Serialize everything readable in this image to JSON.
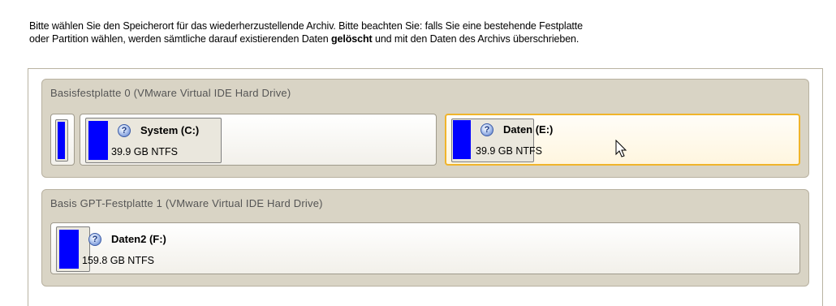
{
  "instructions": {
    "line1": "Bitte wählen Sie den Speicherort für das wiederherzustellende Archiv. Bitte beachten Sie: falls Sie eine bestehende Festplatte",
    "line2_before": "oder Partition wählen, werden sämtliche darauf existierenden Daten ",
    "line2_bold": "gelöscht",
    "line2_after": " und mit den Daten des Archivs überschrieben."
  },
  "disks": [
    {
      "title": "Basisfestplatte 0 (VMware Virtual IDE Hard Drive)",
      "partitions": [
        {
          "name": "System (C:)",
          "info": "39.9 GB NTFS"
        },
        {
          "name": "Daten (E:)",
          "info": "39.9 GB NTFS",
          "selected": true
        }
      ]
    },
    {
      "title": "Basis GPT-Festplatte 1 (VMware Virtual IDE Hard Drive)",
      "partitions": [
        {
          "name": "Daten2 (F:)",
          "info": "159.8 GB NTFS"
        }
      ]
    }
  ],
  "colors": {
    "partition_bar": "#0000ff",
    "selection_border": "#f0b42b"
  },
  "icons": {
    "partition": "question-icon",
    "pointer": "mouse-cursor-icon"
  }
}
